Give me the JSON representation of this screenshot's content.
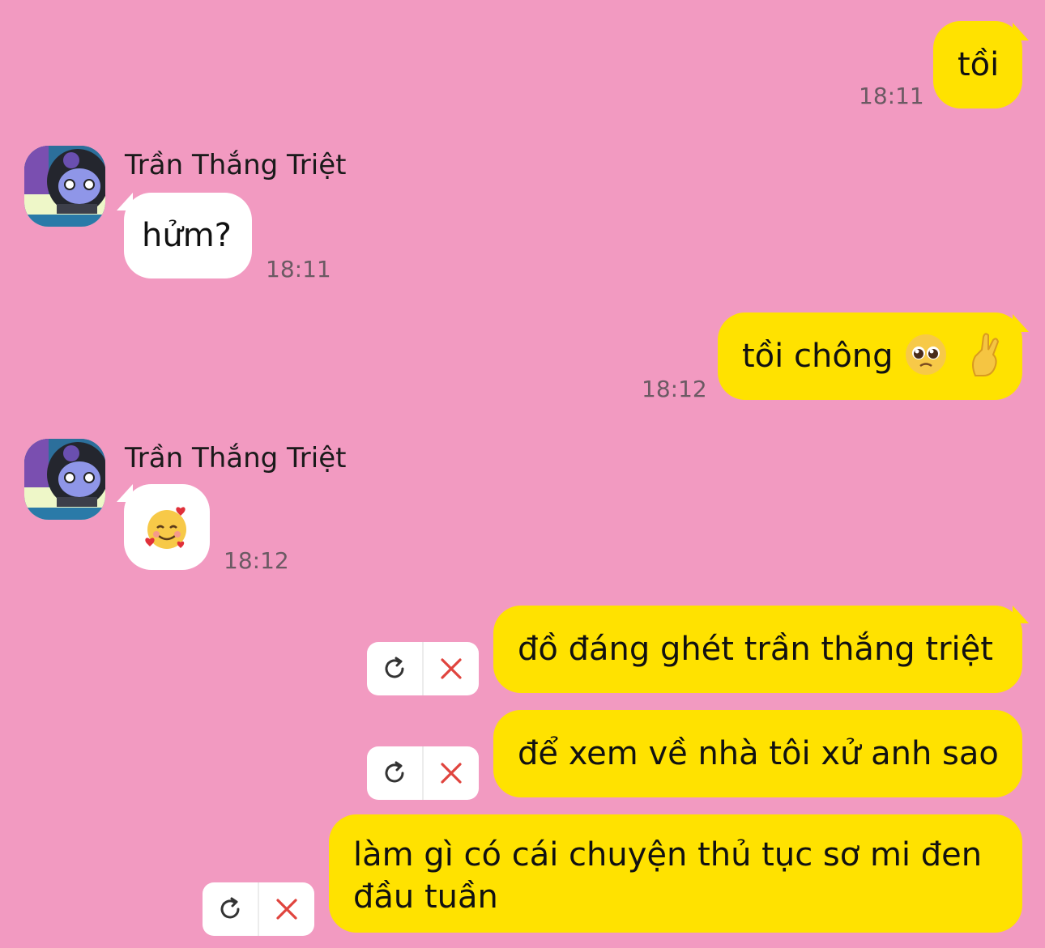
{
  "messages": [
    {
      "text": "tồi",
      "time": "18:11"
    },
    {
      "sender": "Trần Thắng Triệt",
      "text": "hửm?",
      "time": "18:11"
    },
    {
      "text": "tồi chông",
      "emojis": [
        "pleading-face",
        "crossed-fingers"
      ],
      "time": "18:12"
    },
    {
      "sender": "Trần Thắng Triệt",
      "emoji": "smiling-face-with-hearts",
      "time": "18:12"
    },
    {
      "text": "đồ đáng ghét trần thắng triệt",
      "status": "failed"
    },
    {
      "text": "để xem về nhà tôi xử anh sao",
      "status": "failed"
    },
    {
      "text": "làm gì có cái chuyện thủ tục sơ mi đen",
      "text2": "đầu tuần",
      "status": "failed"
    }
  ],
  "colors": {
    "background": "#f29ac1",
    "outgoing_bubble": "#ffe200",
    "incoming_bubble": "#ffffff",
    "retry_icon": "#333333",
    "delete_icon": "#e0443e"
  }
}
